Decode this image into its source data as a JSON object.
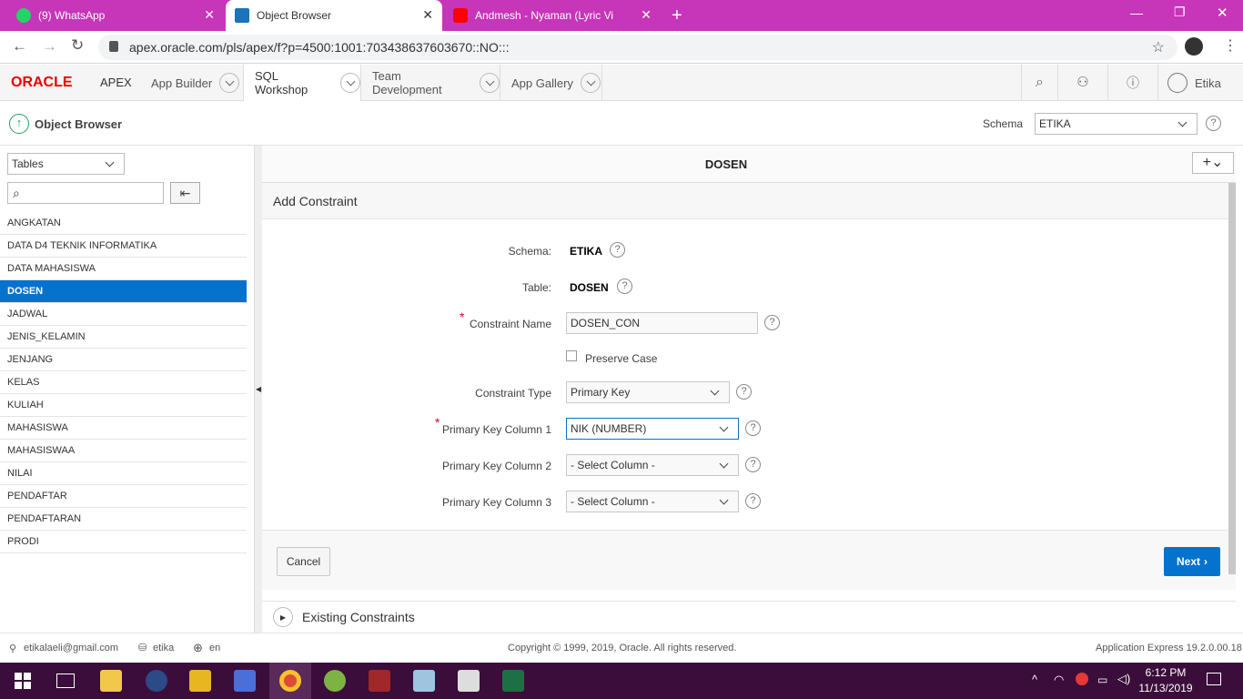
{
  "browser": {
    "tabs": [
      {
        "title": "(9) WhatsApp",
        "icon": "whatsapp-icon",
        "color": "#25d366"
      },
      {
        "title": "Object Browser",
        "icon": "apex-icon",
        "color": "#1b73b9"
      },
      {
        "title": "Andmesh - Nyaman (Lyric Vi",
        "icon": "youtube-icon",
        "color": "#ff0000"
      }
    ],
    "url": "apex.oracle.com/pls/apex/f?p=4500:1001:703438637603670::NO:::"
  },
  "apex": {
    "brand": "ORACLE",
    "product": "APEX",
    "nav": [
      "App Builder",
      "SQL Workshop",
      "Team Development",
      "App Gallery"
    ],
    "user": "Etika"
  },
  "subbar": {
    "title": "Object Browser",
    "schema_label": "Schema",
    "schema_value": "ETIKA"
  },
  "sidebar": {
    "object_type": "Tables",
    "search_placeholder": "",
    "tables": [
      "ANGKATAN",
      "DATA D4 TEKNIK INFORMATIKA",
      "DATA MAHASISWA",
      "DOSEN",
      "JADWAL",
      "JENIS_KELAMIN",
      "JENJANG",
      "KELAS",
      "KULIAH",
      "MAHASISWA",
      "MAHASISWAA",
      "NILAI",
      "PENDAFTAR",
      "PENDAFTARAN",
      "PRODI"
    ],
    "selected": "DOSEN"
  },
  "main": {
    "object_title": "DOSEN",
    "section_title": "Add Constraint",
    "form": {
      "schema_label": "Schema:",
      "schema_value": "ETIKA",
      "table_label": "Table:",
      "table_value": "DOSEN",
      "constraint_name_label": "Constraint Name",
      "constraint_name_value": "DOSEN_CON",
      "preserve_case_label": "Preserve Case",
      "constraint_type_label": "Constraint Type",
      "constraint_type_value": "Primary Key",
      "pk1_label": "Primary Key Column 1",
      "pk1_value": "NIK (NUMBER)",
      "pk2_label": "Primary Key Column 2",
      "pk2_value": "- Select Column -",
      "pk3_label": "Primary Key Column 3",
      "pk3_value": "- Select Column -"
    },
    "cancel_label": "Cancel",
    "next_label": "Next",
    "existing_label": "Existing Constraints"
  },
  "footer": {
    "email": "etikalaeli@gmail.com",
    "workspace": "etika",
    "language": "en",
    "copyright": "Copyright © 1999, 2019, Oracle. All rights reserved.",
    "version": "Application Express 19.2.0.00.18"
  },
  "taskbar": {
    "time": "6:12 PM",
    "date": "11/13/2019"
  }
}
